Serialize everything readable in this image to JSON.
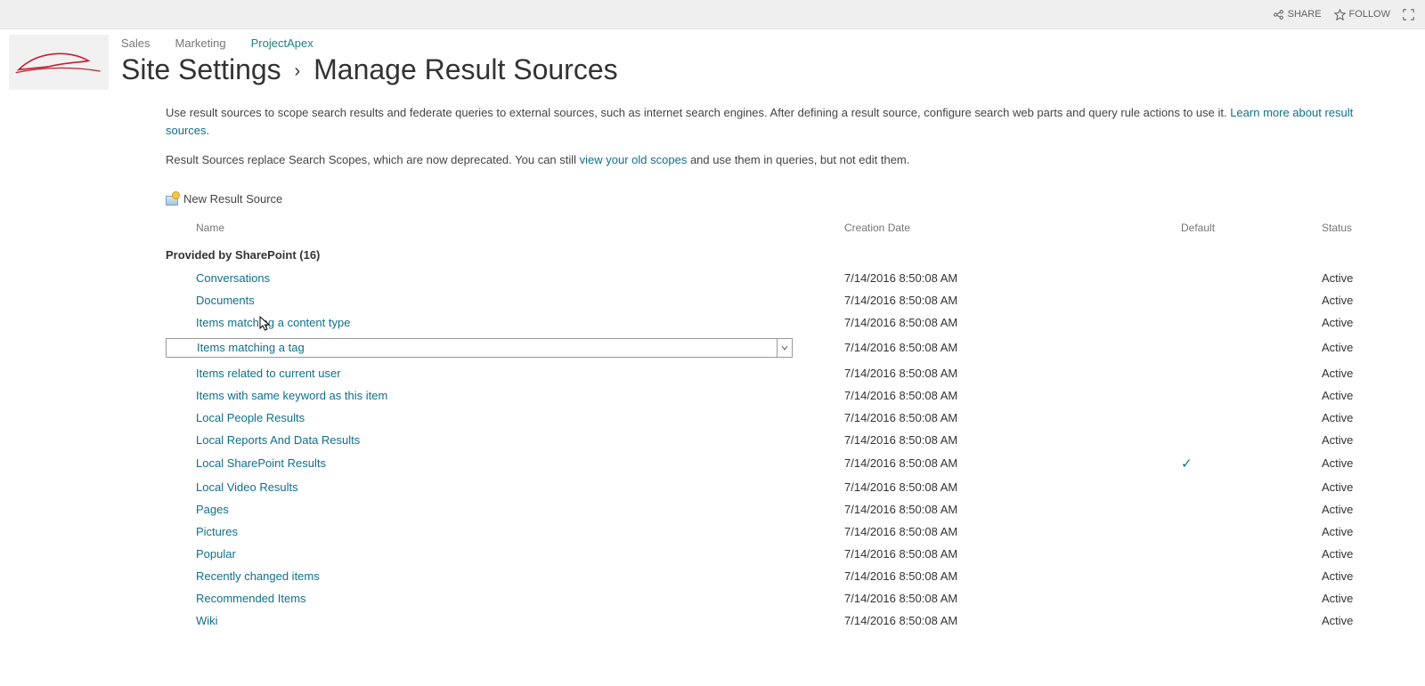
{
  "ribbon": {
    "share": "SHARE",
    "follow": "FOLLOW"
  },
  "nav": {
    "items": [
      {
        "label": "Sales",
        "active": false
      },
      {
        "label": "Marketing",
        "active": false
      },
      {
        "label": "ProjectApex",
        "active": true
      }
    ]
  },
  "breadcrumb": {
    "root": "Site Settings",
    "page": "Manage Result Sources"
  },
  "intro": {
    "p1a": "Use result sources to scope search results and federate queries to external sources, such as internet search engines. After defining a result source, configure search web parts and query rule actions to use it. ",
    "p1link": "Learn more about result sources.",
    "p2a": "Result Sources replace Search Scopes, which are now deprecated. You can still ",
    "p2link": "view your old scopes",
    "p2b": " and use them in queries, but not edit them."
  },
  "newSource": "New Result Source",
  "columns": {
    "name": "Name",
    "date": "Creation Date",
    "def": "Default",
    "status": "Status"
  },
  "group": {
    "title": "Provided by SharePoint (16)"
  },
  "rows": [
    {
      "name": "Conversations",
      "date": "7/14/2016 8:50:08 AM",
      "def": false,
      "status": "Active",
      "sel": false
    },
    {
      "name": "Documents",
      "date": "7/14/2016 8:50:08 AM",
      "def": false,
      "status": "Active",
      "sel": false
    },
    {
      "name": "Items matching a content type",
      "date": "7/14/2016 8:50:08 AM",
      "def": false,
      "status": "Active",
      "sel": false
    },
    {
      "name": "Items matching a tag",
      "date": "7/14/2016 8:50:08 AM",
      "def": false,
      "status": "Active",
      "sel": true
    },
    {
      "name": "Items related to current user",
      "date": "7/14/2016 8:50:08 AM",
      "def": false,
      "status": "Active",
      "sel": false
    },
    {
      "name": "Items with same keyword as this item",
      "date": "7/14/2016 8:50:08 AM",
      "def": false,
      "status": "Active",
      "sel": false
    },
    {
      "name": "Local People Results",
      "date": "7/14/2016 8:50:08 AM",
      "def": false,
      "status": "Active",
      "sel": false
    },
    {
      "name": "Local Reports And Data Results",
      "date": "7/14/2016 8:50:08 AM",
      "def": false,
      "status": "Active",
      "sel": false
    },
    {
      "name": "Local SharePoint Results",
      "date": "7/14/2016 8:50:08 AM",
      "def": true,
      "status": "Active",
      "sel": false
    },
    {
      "name": "Local Video Results",
      "date": "7/14/2016 8:50:08 AM",
      "def": false,
      "status": "Active",
      "sel": false
    },
    {
      "name": "Pages",
      "date": "7/14/2016 8:50:08 AM",
      "def": false,
      "status": "Active",
      "sel": false
    },
    {
      "name": "Pictures",
      "date": "7/14/2016 8:50:08 AM",
      "def": false,
      "status": "Active",
      "sel": false
    },
    {
      "name": "Popular",
      "date": "7/14/2016 8:50:08 AM",
      "def": false,
      "status": "Active",
      "sel": false
    },
    {
      "name": "Recently changed items",
      "date": "7/14/2016 8:50:08 AM",
      "def": false,
      "status": "Active",
      "sel": false
    },
    {
      "name": "Recommended Items",
      "date": "7/14/2016 8:50:08 AM",
      "def": false,
      "status": "Active",
      "sel": false
    },
    {
      "name": "Wiki",
      "date": "7/14/2016 8:50:08 AM",
      "def": false,
      "status": "Active",
      "sel": false
    }
  ],
  "checkmark": "✓"
}
